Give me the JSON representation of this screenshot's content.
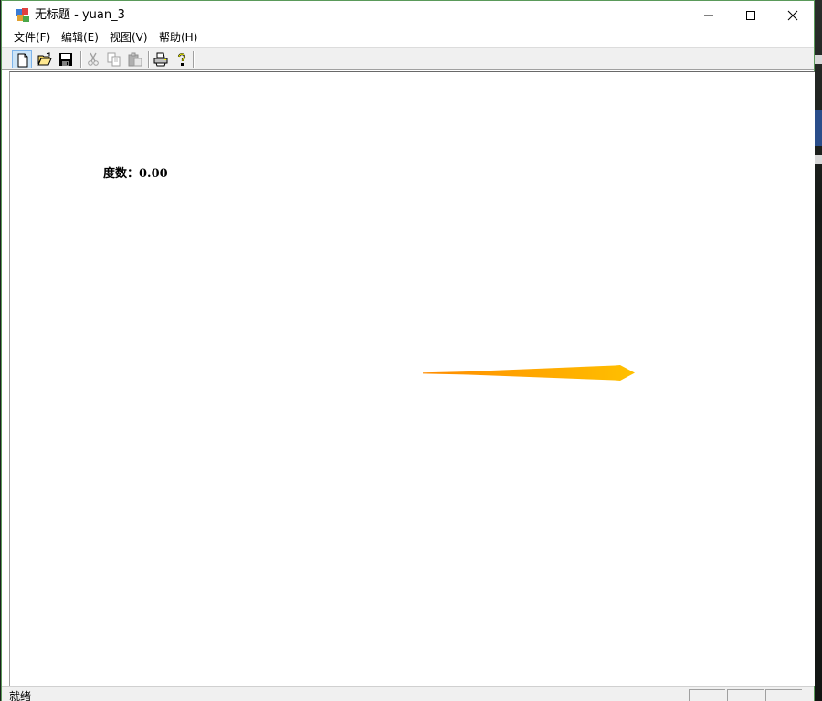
{
  "window": {
    "title": "无标题 - yuan_3",
    "controls": [
      "minimize-icon",
      "maximize-icon",
      "close-icon"
    ]
  },
  "menu": {
    "items": [
      {
        "label": "文件(F)"
      },
      {
        "label": "编辑(E)"
      },
      {
        "label": "视图(V)"
      },
      {
        "label": "帮助(H)"
      }
    ]
  },
  "toolbar": {
    "buttons": [
      {
        "icon": "new-file-icon",
        "enabled": true,
        "pressed": true
      },
      {
        "icon": "open-folder-icon",
        "enabled": true
      },
      {
        "icon": "save-icon",
        "enabled": true
      },
      {
        "icon": "cut-icon",
        "enabled": false
      },
      {
        "icon": "copy-icon",
        "enabled": false
      },
      {
        "icon": "paste-icon",
        "enabled": false
      },
      {
        "icon": "print-icon",
        "enabled": true
      },
      {
        "icon": "help-icon",
        "enabled": true
      }
    ]
  },
  "canvas": {
    "degree_label": "度数：0.00",
    "needle_colors": {
      "tail": "#ff8c00",
      "tip": "#ffc000"
    }
  },
  "statusbar": {
    "text": "就绪"
  }
}
